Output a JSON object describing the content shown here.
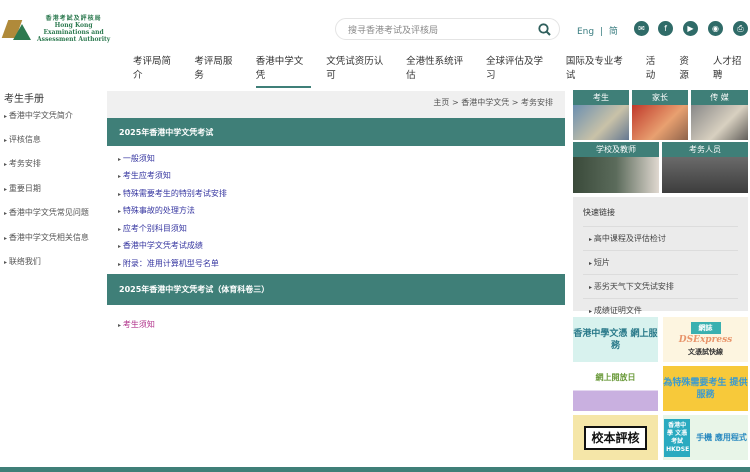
{
  "header": {
    "logo_text": [
      "香港考試及評核局",
      "Hong Kong",
      "Examinations and",
      "Assessment Authority"
    ],
    "search_placeholder": "搜寻香港考试及评核局",
    "lang_eng": "Eng",
    "lang_sep": "|",
    "lang_sc": "简",
    "social_icons": [
      "email-icon",
      "facebook-icon",
      "youtube-icon",
      "rss-icon",
      "print-icon"
    ]
  },
  "nav": [
    "考评局简介",
    "考评局服务",
    "香港中学文凭",
    "文凭试资历认可",
    "全港性系统评估",
    "全球评估及学习",
    "国际及专业考试",
    "活动",
    "资源",
    "人才招聘"
  ],
  "sidebar": {
    "title": "考生手册",
    "items": [
      "香港中学文凭简介",
      "评核信息",
      "考务安排",
      "重要日期",
      "香港中学文凭常见问题",
      "香港中学文凭相关信息",
      "联络我们"
    ]
  },
  "main": {
    "breadcrumb": "主页 > 香港中学文凭 > 考务安排",
    "section1": {
      "title": "2025年香港中学文凭考试",
      "links": [
        "一般须知",
        "考生应考须知",
        "特殊需要考生的特别考试安排",
        "特殊事故的处理方法",
        "应考个别科目须知",
        "香港中学文凭考试成绩",
        "附录：准用计算机型号名单"
      ]
    },
    "section2": {
      "title": "2025年香港中学文凭考试（体育科卷三）",
      "links": [
        "考生须知"
      ]
    }
  },
  "right": {
    "tiles": [
      "考生",
      "家长",
      "传 媒",
      "学校及教师",
      "考务人员"
    ],
    "quick_title": "快速链接",
    "quick_links": [
      "高中课程及评估检讨",
      "短片",
      "恶劣天气下文凭试安排",
      "成绩证明文件"
    ],
    "banners": {
      "b1": "香港中學文憑 網上服務",
      "b2_tag": "網誌",
      "b2_title": "DSExpress",
      "b2_sub": "文憑試快線",
      "b3": "網上開放日",
      "b4": "為特殊需要考生 提供服務",
      "b5": "校本評核",
      "b6_box": "香港中學 文憑考試 HKDSE",
      "b6": "手機 應用程式"
    }
  },
  "colors": {
    "accent": "#3f7f78",
    "link": "#3535a0",
    "visited": "#b0308a"
  }
}
